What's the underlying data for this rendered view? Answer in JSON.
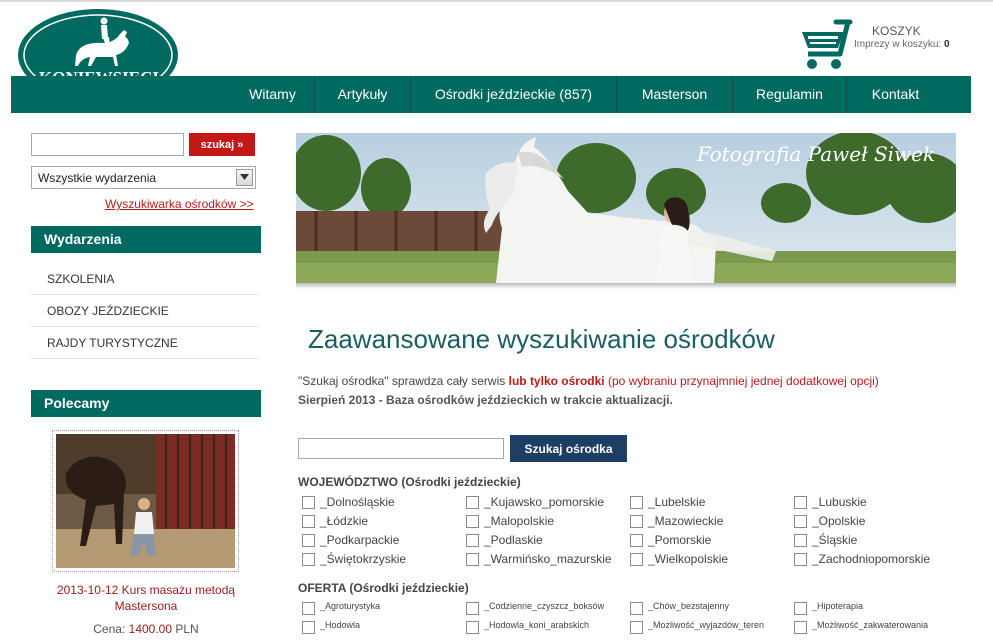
{
  "header": {
    "logo_text": "KONIEWSIECI",
    "cart": {
      "title": "KOSZYK",
      "info_label": "Imprezy w koszyku:",
      "info_count": "0"
    }
  },
  "nav": [
    "Witamy",
    "Artykuły",
    "Ośrodki jeździeckie (857)",
    "Masterson",
    "Regulamin",
    "Kontakt"
  ],
  "sidebar": {
    "search_value": "",
    "search_button": "szukaj »",
    "select_value": "Wszystkie wydarzenia",
    "advanced_link": "Wyszukiwarka ośrodków >>",
    "events_heading": "Wydarzenia",
    "events": [
      "SZKOLENIA",
      "OBOZY JEŹDZIECKIE",
      "RAJDY TURYSTYCZNE"
    ],
    "recommend_heading": "Polecamy",
    "promo": {
      "title": "2013-10-12 Kurs masażu metodą Mastersona",
      "price_label": "Cena:",
      "price_value": "1400.00",
      "currency": "PLN"
    }
  },
  "banner": {
    "signature": "Fotografia Paweł Siwek"
  },
  "main": {
    "title": "Zaawansowane wyszukiwanie ośrodków",
    "desc_start": "\"Szukaj ośrodka\" sprawdza cały serwis ",
    "desc_bold": "lub tylko ośrodki",
    "desc_end": " (po wybraniu przynajmniej jednej dodatkowej opcji)",
    "note": "Sierpień 2013 - Baza ośrodków jeździeckich w trakcie aktualizacji.",
    "search_value": "",
    "search_button": "Szukaj ośrodka",
    "voivodeship_heading": "WOJEWÓDZTWO (Ośrodki jeździeckie)",
    "voivodeships": [
      "_Dolnośląskie",
      "_Kujawsko_pomorskie",
      "_Lubelskie",
      "_Lubuskie",
      "_Łódzkie",
      "_Malopolskie",
      "_Mazowieckie",
      "_Opolskie",
      "_Podkarpackie",
      "_Podlaskie",
      "_Pomorskie",
      "_Śląskie",
      "_Świętokrzyskie",
      "_Warmińsko_mazurskie",
      "_Wielkopolskie",
      "_Zachodniopomorskie"
    ],
    "offer_heading": "OFERTA (Ośrodki jeździeckie)",
    "offers": [
      "_Agroturystyka",
      "_Codzienne_czyszcz_boksów",
      "_Chów_bezstajenny",
      "_Hipoterapia",
      "_Hodowla",
      "_Hodowla_koni_arabskich",
      "_Możliwość_wyjazdów_teren",
      "_Możliwość_zakwaterowania"
    ]
  },
  "colors": {
    "brand_green": "#006a60",
    "accent_red": "#c21818",
    "button_navy": "#1d3f66",
    "title_teal": "#1a5e62"
  }
}
